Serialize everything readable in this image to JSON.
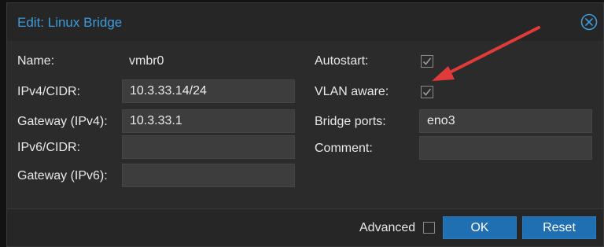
{
  "dialog": {
    "title": "Edit: Linux Bridge"
  },
  "left": {
    "name_label": "Name:",
    "name_value": "vmbr0",
    "ipv4_label": "IPv4/CIDR:",
    "ipv4_value": "10.3.33.14/24",
    "gw4_label": "Gateway (IPv4):",
    "gw4_value": "10.3.33.1",
    "ipv6_label": "IPv6/CIDR:",
    "ipv6_value": "",
    "gw6_label": "Gateway (IPv6):",
    "gw6_value": ""
  },
  "right": {
    "autostart_label": "Autostart:",
    "autostart_checked": true,
    "vlan_label": "VLAN aware:",
    "vlan_checked": true,
    "ports_label": "Bridge ports:",
    "ports_value": "eno3",
    "comment_label": "Comment:",
    "comment_value": ""
  },
  "footer": {
    "advanced_label": "Advanced",
    "advanced_checked": false,
    "ok_label": "OK",
    "reset_label": "Reset"
  },
  "colors": {
    "title": "#3d9bdb",
    "button": "#1f6fb2",
    "arrow": "#e03a3a"
  },
  "icons": [
    "close-icon",
    "check-icon",
    "red-arrow-annotation"
  ]
}
